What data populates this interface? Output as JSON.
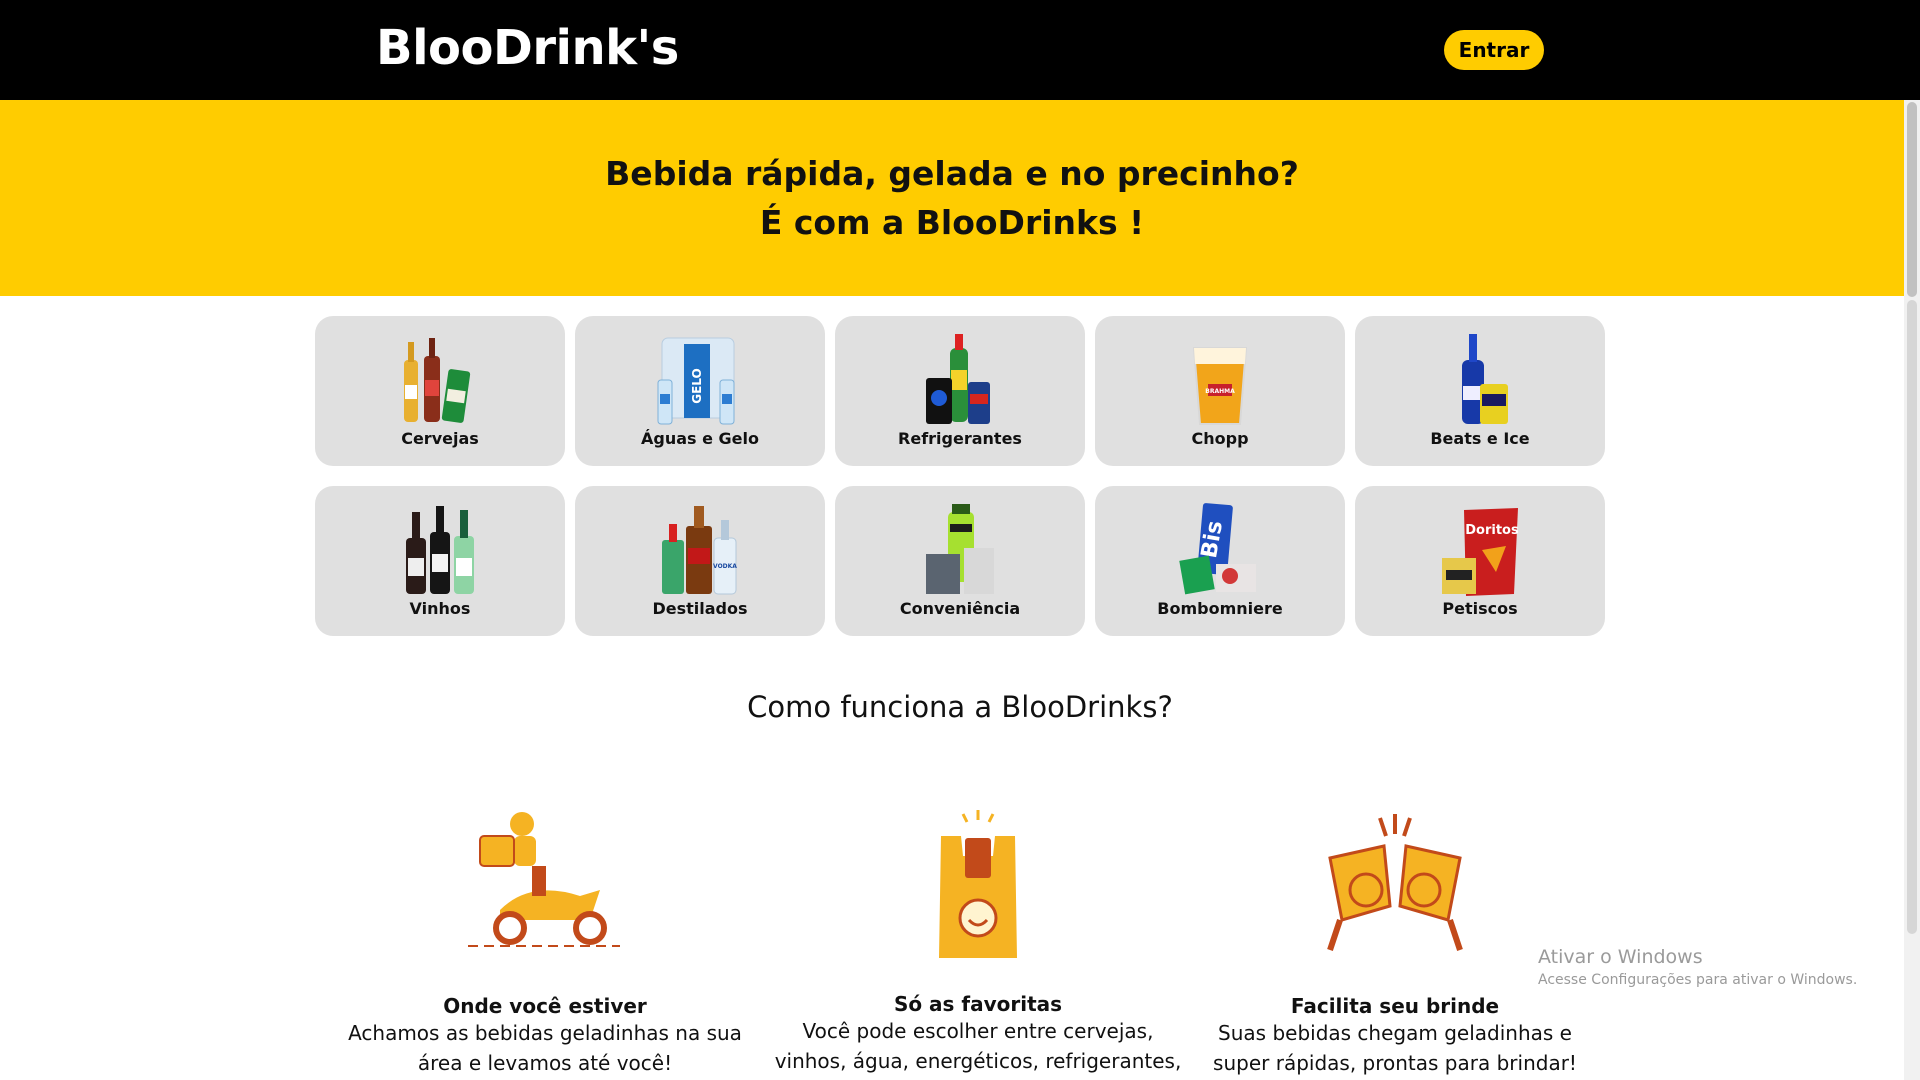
{
  "header": {
    "brand": "BlooDrink's",
    "login_label": "Entrar"
  },
  "hero": {
    "line1": "Bebida rápida, gelada e no precinho?",
    "line2": "É com a BlooDrinks !"
  },
  "categories": [
    {
      "label": "Cervejas",
      "icon": "beer-bottles-icon"
    },
    {
      "label": "Águas e Gelo",
      "icon": "water-ice-icon"
    },
    {
      "label": "Refrigerantes",
      "icon": "soda-icon"
    },
    {
      "label": "Chopp",
      "icon": "draft-beer-icon"
    },
    {
      "label": "Beats e Ice",
      "icon": "beats-ice-icon"
    },
    {
      "label": "Vinhos",
      "icon": "wine-bottles-icon"
    },
    {
      "label": "Destilados",
      "icon": "spirits-icon"
    },
    {
      "label": "Conveniência",
      "icon": "convenience-icon"
    },
    {
      "label": "Bombomniere",
      "icon": "candy-icon"
    },
    {
      "label": "Petiscos",
      "icon": "snacks-icon"
    }
  ],
  "how": {
    "title": "Como funciona a BlooDrinks?",
    "steps": [
      {
        "title": "Onde você estiver",
        "desc1": "Achamos as bebidas geladinhas na sua",
        "desc2": "área e levamos até você!",
        "icon": "delivery-scooter-icon"
      },
      {
        "title": "Só as favoritas",
        "desc1": "Você pode escolher entre cervejas,",
        "desc2": "vinhos, água, energéticos, refrigerantes,",
        "icon": "shopping-bag-icon"
      },
      {
        "title": "Facilita seu brinde",
        "desc1": "Suas bebidas chegam geladinhas e",
        "desc2": "super rápidas, prontas para brindar!",
        "icon": "cheers-icon"
      }
    ]
  },
  "watermark": {
    "line1": "Ativar o Windows",
    "line2": "Acesse Configurações para ativar o Windows."
  },
  "colors": {
    "accent": "#ffcc00",
    "header_bg": "#000000",
    "card_bg": "#e0e0e0"
  }
}
